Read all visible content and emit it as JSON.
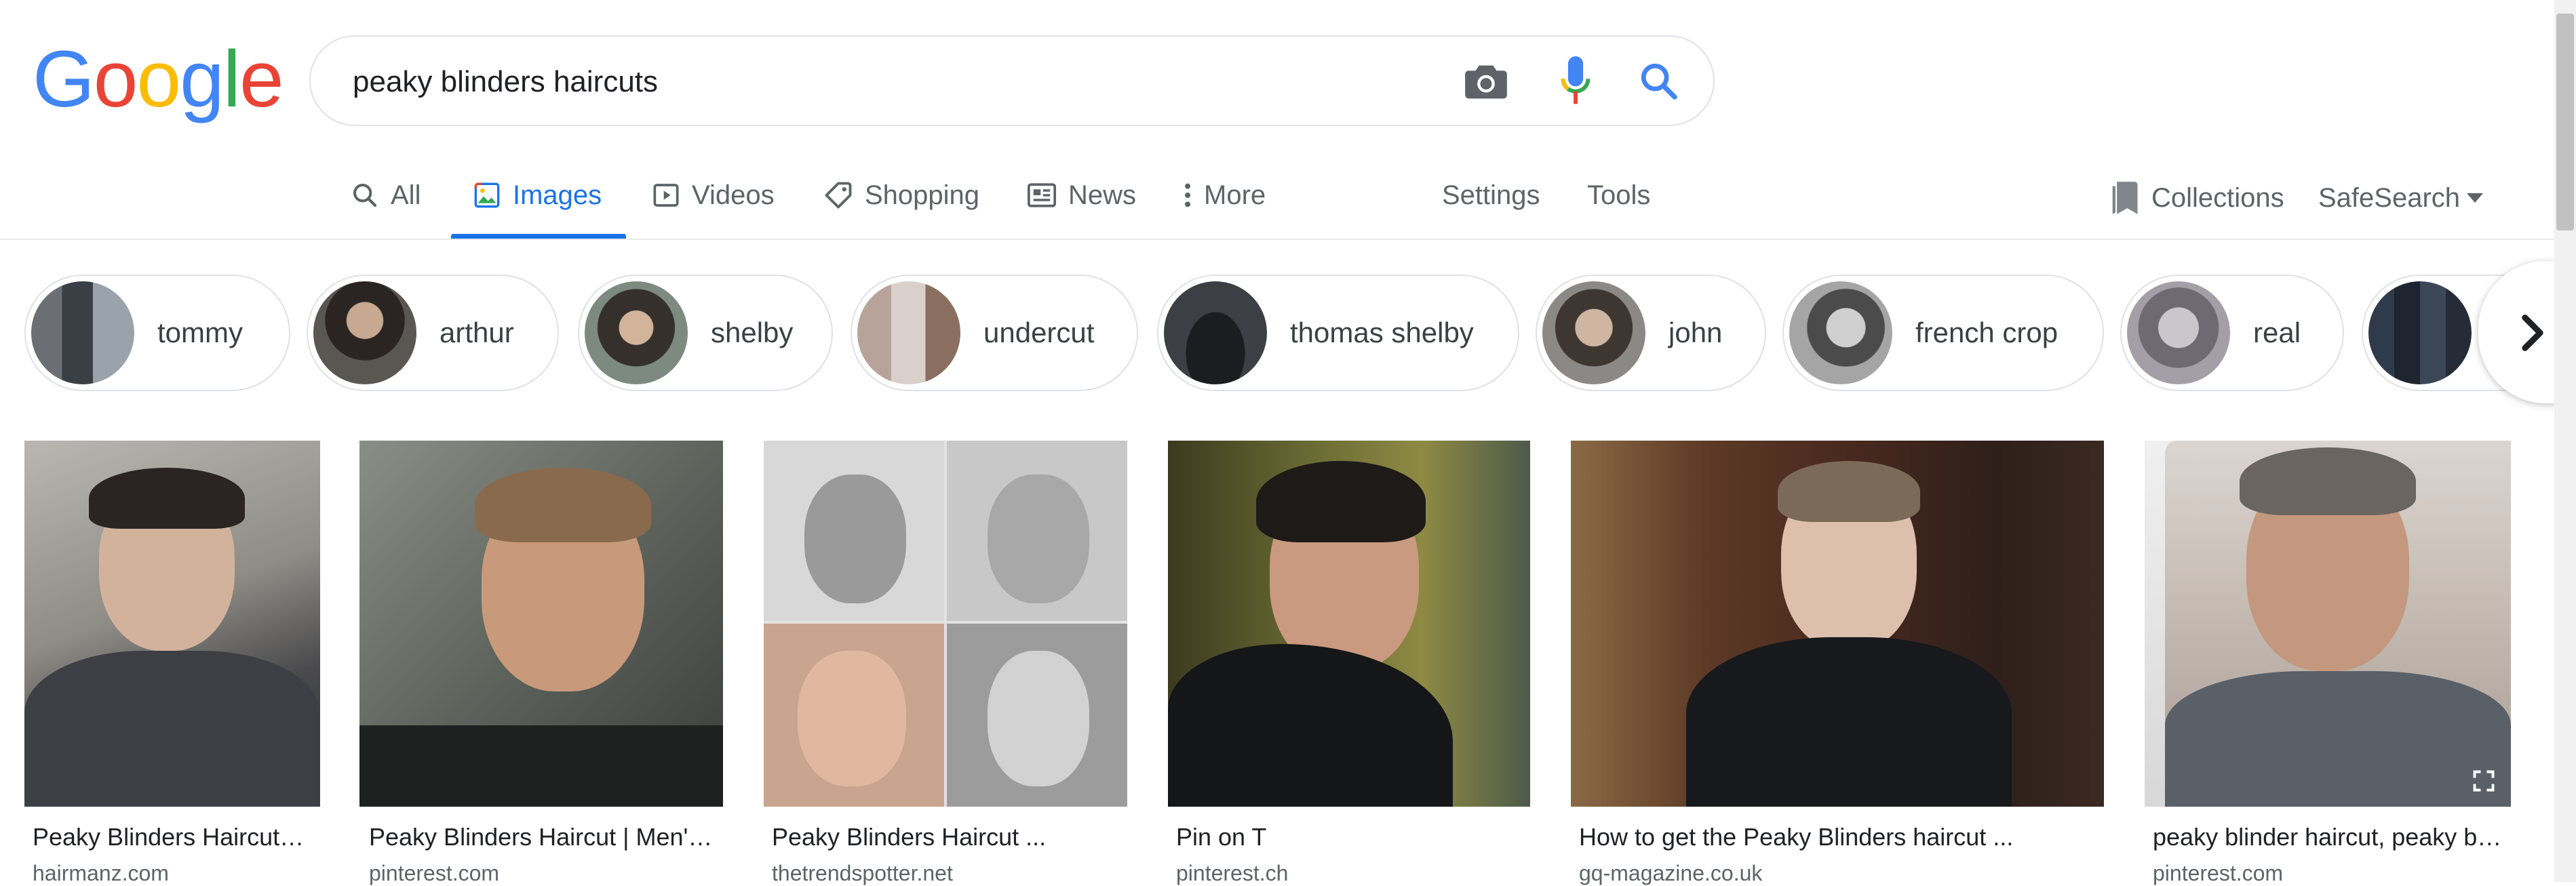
{
  "logo": {
    "letters": [
      "G",
      "o",
      "o",
      "g",
      "l",
      "e"
    ],
    "colors": [
      "#4285F4",
      "#EA4335",
      "#FBBC05",
      "#4285F4",
      "#34A853",
      "#EA4335"
    ]
  },
  "search": {
    "query": "peaky blinders haircuts"
  },
  "tabs": [
    {
      "label": "All",
      "icon": "search-icon"
    },
    {
      "label": "Images",
      "icon": "image-icon",
      "active": true
    },
    {
      "label": "Videos",
      "icon": "play-icon"
    },
    {
      "label": "Shopping",
      "icon": "tag-icon"
    },
    {
      "label": "News",
      "icon": "newspaper-icon"
    },
    {
      "label": "More",
      "icon": "more-vert-icon"
    }
  ],
  "tools": {
    "settings": "Settings",
    "tools": "Tools",
    "collections": "Collections",
    "safesearch": "SafeSearch"
  },
  "chips": [
    "tommy",
    "arthur",
    "shelby",
    "undercut",
    "thomas shelby",
    "john",
    "french crop",
    "real"
  ],
  "results": [
    {
      "title": "Peaky Blinders Haircut…",
      "source": "hairmanz.com"
    },
    {
      "title": "Peaky Blinders Haircut | Men'…",
      "source": "pinterest.com"
    },
    {
      "title": "Peaky Blinders Haircut ...",
      "source": "thetrendspotter.net"
    },
    {
      "title": "Pin on T",
      "source": "pinterest.ch"
    },
    {
      "title": "How to get the Peaky Blinders haircut ...",
      "source": "gq-magazine.co.uk"
    },
    {
      "title": "peaky blinder haircut, peaky b…",
      "source": "pinterest.com"
    }
  ],
  "colors": {
    "accent": "#1a73e8",
    "border": "#dfe1e5",
    "text_secondary": "#5f6368"
  }
}
